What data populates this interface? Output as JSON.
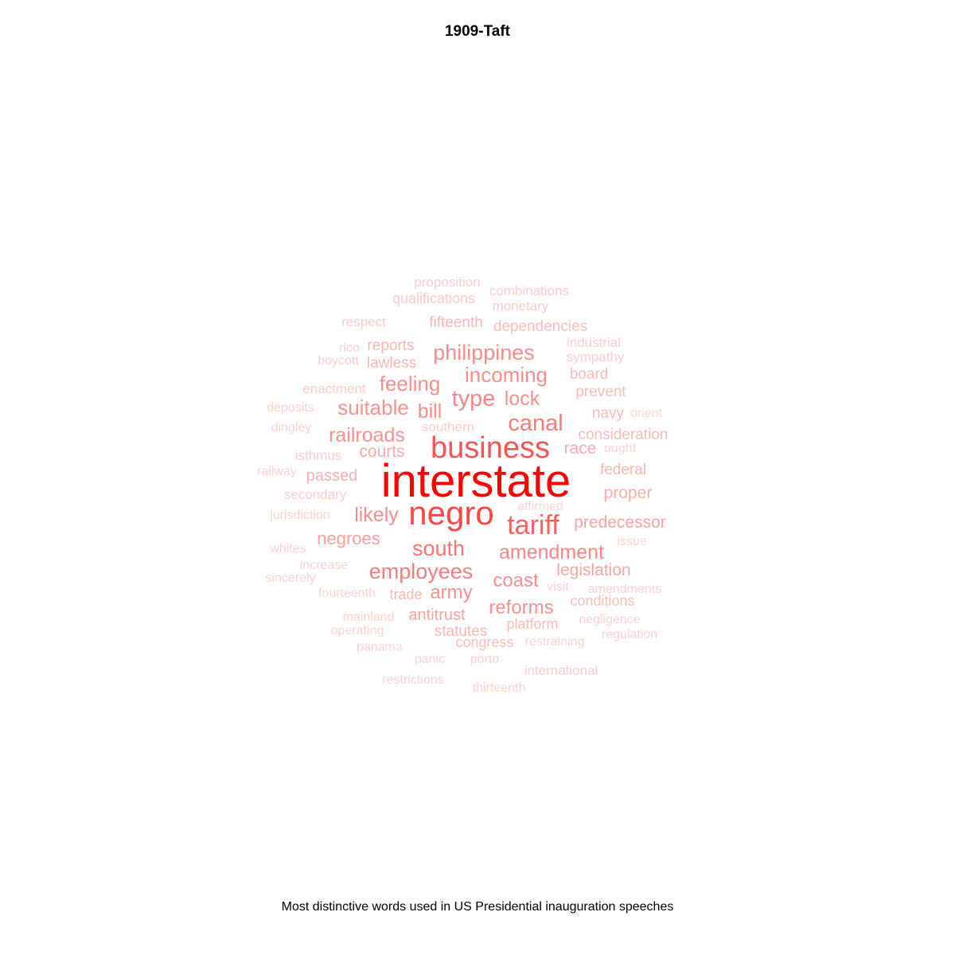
{
  "chart_data": {
    "type": "wordcloud",
    "title": "1909-Taft",
    "caption": "Most distinctive words used in US Presidential inauguration speeches",
    "color": "#ff0000",
    "words": [
      {
        "text": "interstate",
        "weight": 1.0
      },
      {
        "text": "negro",
        "weight": 0.7
      },
      {
        "text": "business",
        "weight": 0.65
      },
      {
        "text": "tariff",
        "weight": 0.6
      },
      {
        "text": "canal",
        "weight": 0.52
      },
      {
        "text": "south",
        "weight": 0.5
      },
      {
        "text": "employees",
        "weight": 0.5
      },
      {
        "text": "amendment",
        "weight": 0.47
      },
      {
        "text": "philippines",
        "weight": 0.45
      },
      {
        "text": "incoming",
        "weight": 0.45
      },
      {
        "text": "type",
        "weight": 0.45
      },
      {
        "text": "feeling",
        "weight": 0.45
      },
      {
        "text": "likely",
        "weight": 0.45
      },
      {
        "text": "railroads",
        "weight": 0.43
      },
      {
        "text": "suitable",
        "weight": 0.43
      },
      {
        "text": "bill",
        "weight": 0.43
      },
      {
        "text": "lock",
        "weight": 0.43
      },
      {
        "text": "coast",
        "weight": 0.43
      },
      {
        "text": "reforms",
        "weight": 0.43
      },
      {
        "text": "army",
        "weight": 0.43
      },
      {
        "text": "negroes",
        "weight": 0.38
      },
      {
        "text": "legislation",
        "weight": 0.38
      },
      {
        "text": "predecessor",
        "weight": 0.38
      },
      {
        "text": "antitrust",
        "weight": 0.38
      },
      {
        "text": "race",
        "weight": 0.36
      },
      {
        "text": "courts",
        "weight": 0.36
      },
      {
        "text": "proper",
        "weight": 0.36
      },
      {
        "text": "passed",
        "weight": 0.34
      },
      {
        "text": "reports",
        "weight": 0.32
      },
      {
        "text": "lawless",
        "weight": 0.32
      },
      {
        "text": "fifteenth",
        "weight": 0.32
      },
      {
        "text": "statutes",
        "weight": 0.32
      },
      {
        "text": "trade",
        "weight": 0.32
      },
      {
        "text": "federal",
        "weight": 0.32
      },
      {
        "text": "consideration",
        "weight": 0.32
      },
      {
        "text": "board",
        "weight": 0.3
      },
      {
        "text": "dependencies",
        "weight": 0.3
      },
      {
        "text": "platform",
        "weight": 0.3
      },
      {
        "text": "congress",
        "weight": 0.3
      },
      {
        "text": "prevent",
        "weight": 0.3
      },
      {
        "text": "navy",
        "weight": 0.3
      },
      {
        "text": "conditions",
        "weight": 0.3
      },
      {
        "text": "qualifications",
        "weight": 0.25
      },
      {
        "text": "proposition",
        "weight": 0.25
      },
      {
        "text": "combinations",
        "weight": 0.25
      },
      {
        "text": "monetary",
        "weight": 0.25
      },
      {
        "text": "respect",
        "weight": 0.25
      },
      {
        "text": "industrial",
        "weight": 0.25
      },
      {
        "text": "sympathy",
        "weight": 0.25
      },
      {
        "text": "rico",
        "weight": 0.25
      },
      {
        "text": "boycott",
        "weight": 0.25
      },
      {
        "text": "enactment",
        "weight": 0.25
      },
      {
        "text": "deposits",
        "weight": 0.25
      },
      {
        "text": "dingley",
        "weight": 0.25
      },
      {
        "text": "southern",
        "weight": 0.25
      },
      {
        "text": "isthmus",
        "weight": 0.25
      },
      {
        "text": "railway",
        "weight": 0.25
      },
      {
        "text": "secondary",
        "weight": 0.25
      },
      {
        "text": "jurisdiction",
        "weight": 0.25
      },
      {
        "text": "whites",
        "weight": 0.25
      },
      {
        "text": "increase",
        "weight": 0.25
      },
      {
        "text": "sincerely",
        "weight": 0.25
      },
      {
        "text": "fourteenth",
        "weight": 0.25
      },
      {
        "text": "mainland",
        "weight": 0.25
      },
      {
        "text": "operating",
        "weight": 0.25
      },
      {
        "text": "panama",
        "weight": 0.25
      },
      {
        "text": "panic",
        "weight": 0.25
      },
      {
        "text": "porto",
        "weight": 0.25
      },
      {
        "text": "restrictions",
        "weight": 0.25
      },
      {
        "text": "thirteenth",
        "weight": 0.25
      },
      {
        "text": "international",
        "weight": 0.25
      },
      {
        "text": "restraining",
        "weight": 0.25
      },
      {
        "text": "regulation",
        "weight": 0.25
      },
      {
        "text": "negligence",
        "weight": 0.25
      },
      {
        "text": "amendments",
        "weight": 0.25
      },
      {
        "text": "visit",
        "weight": 0.25
      },
      {
        "text": "issue",
        "weight": 0.25
      },
      {
        "text": "affirmed",
        "weight": 0.25
      },
      {
        "text": "ought",
        "weight": 0.25
      },
      {
        "text": "orient",
        "weight": 0.25
      }
    ]
  }
}
